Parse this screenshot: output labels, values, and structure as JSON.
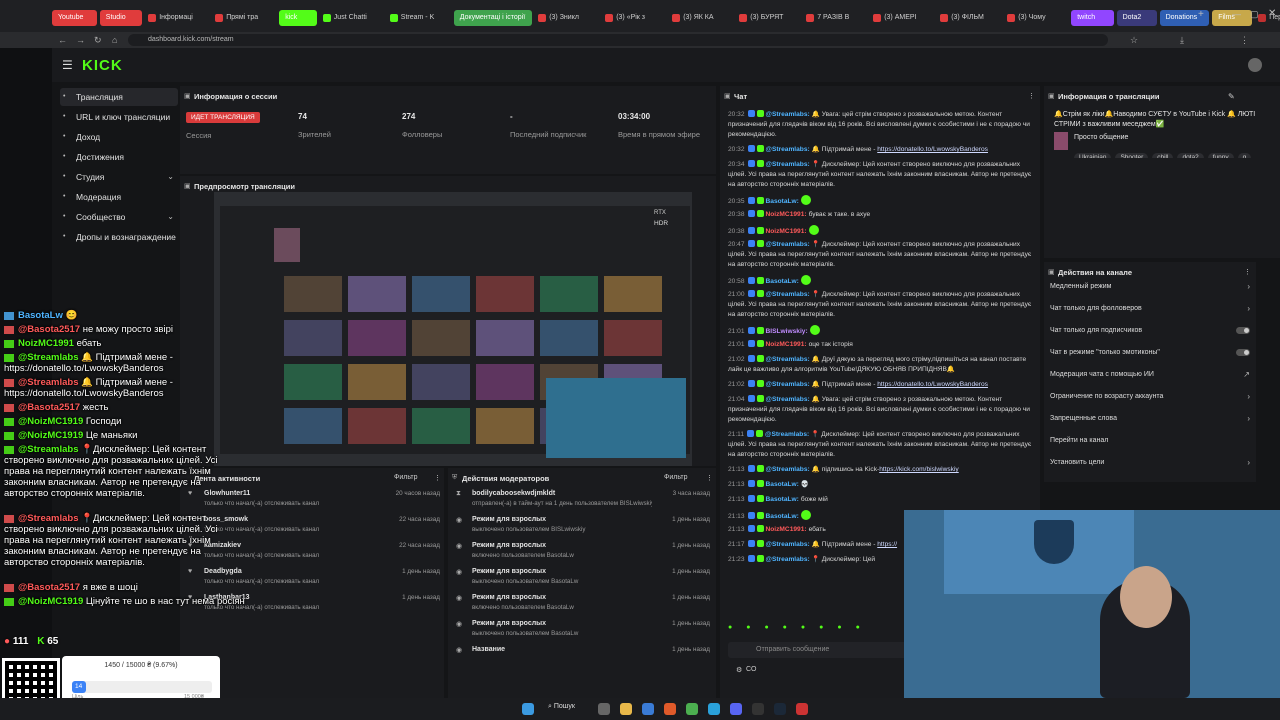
{
  "browser": {
    "tabs": [
      {
        "label": "Youtube",
        "color": "#e03c3c",
        "pill": true
      },
      {
        "label": "Studio",
        "color": "#e03c3c",
        "pill": true
      },
      {
        "label": "Інформаці",
        "color": "#e03c3c"
      },
      {
        "label": "Прямі тра",
        "color": "#e03c3c"
      },
      {
        "label": "kick",
        "color": "#53fc18",
        "pill": true
      },
      {
        "label": "Just Chatti",
        "color": "#53fc18"
      },
      {
        "label": "Stream - K",
        "color": "#53fc18"
      },
      {
        "label": "Документаці і історії",
        "color": "#3fa34d",
        "pill": true
      },
      {
        "label": "(3) Зникл",
        "color": "#e03c3c"
      },
      {
        "label": "(3) «Рік з",
        "color": "#e03c3c"
      },
      {
        "label": "(3) ЯК КА",
        "color": "#e03c3c"
      },
      {
        "label": "(3) БУРЯТ",
        "color": "#e03c3c"
      },
      {
        "label": "7 РАЗІВ В",
        "color": "#e03c3c"
      },
      {
        "label": "(3) АМЕРІ",
        "color": "#e03c3c"
      },
      {
        "label": "(3) ФІЛЬМ",
        "color": "#e03c3c"
      },
      {
        "label": "(3) Чому",
        "color": "#e03c3c"
      },
      {
        "label": "twitch",
        "color": "#9146ff",
        "pill": true
      },
      {
        "label": "Dota2",
        "color": "#3a3a7a",
        "pill": true
      },
      {
        "label": "Donations",
        "color": "#2f5fb3",
        "pill": true
      },
      {
        "label": "Films",
        "color": "#c7a84a",
        "pill": true
      },
      {
        "label": "Персона",
        "color": "#c03030"
      }
    ],
    "url": "dashboard.kick.com/stream",
    "new_tab": "+"
  },
  "app": {
    "logo": "KICK",
    "sidebar": [
      {
        "label": "Трансляция",
        "active": true
      },
      {
        "label": "URL и ключ трансляции"
      },
      {
        "label": "Доход"
      },
      {
        "label": "Достижения"
      },
      {
        "label": "Студия",
        "chev": "⌄"
      },
      {
        "label": "Модерация"
      },
      {
        "label": "Сообщество",
        "chev": "⌄"
      },
      {
        "label": "Дропы и вознаграждение"
      }
    ],
    "session": {
      "title": "Информация о сессии",
      "badge": "ИДЕТ ТРАНСЛЯЦИЯ",
      "badge_label": "Сессия",
      "stats": [
        {
          "value": "74",
          "label": "Зрителей"
        },
        {
          "value": "274",
          "label": "Фолловеры"
        },
        {
          "value": "-",
          "label": "Последний подписчик"
        },
        {
          "value": "03:34:00",
          "label": "Время в прямом эфире"
        }
      ]
    },
    "preview": {
      "title": "Предпросмотр трансляции",
      "hdr": "HDR",
      "rtx": "RTX"
    },
    "chat": {
      "title": "Чат",
      "input_placeholder": "Отправить сообщение",
      "viewers_mini": "CO",
      "messages": [
        {
          "t": "20:32",
          "u": "@Streamlabs:",
          "c": "#4fb4ff",
          "m": "🔔 Увага: цей стрім створено з розважальною метою. Контент призначений для глядачів віком від 16 років. Всі висловлені думки є особистими і не є порадою чи рекомендацією."
        },
        {
          "t": "20:32",
          "u": "@Streamlabs:",
          "c": "#4fb4ff",
          "m": "🔔 Підтримай мене - ",
          "link": "https://donatello.to/LwowskyBanderos"
        },
        {
          "t": "20:34",
          "u": "@Streamlabs:",
          "c": "#4fb4ff",
          "m": "📍 Дисклеймер: Цей контент створено виключно для розважальних цілей. Усі права на переглянутий контент належать їхнім законним власникам. Автор не претендує на авторство сторонніх матеріалів."
        },
        {
          "t": "20:35",
          "u": "BasotaLw:",
          "c": "#4fb4ff",
          "m": "",
          "emo": true
        },
        {
          "t": "20:38",
          "u": "NoizMC1991:",
          "c": "#ff5a5a",
          "m": "буває ж таке. в ахуе"
        },
        {
          "t": "20:38",
          "u": "NoizMC1991:",
          "c": "#ff5a5a",
          "m": "",
          "emo": true
        },
        {
          "t": "20:47",
          "u": "@Streamlabs:",
          "c": "#4fb4ff",
          "m": "📍 Дисклеймер: Цей контент створено виключно для розважальних цілей. Усі права на переглянутий контент належать їхнім законним власникам. Автор не претендує на авторство сторонніх матеріалів."
        },
        {
          "t": "20:58",
          "u": "BasotaLw:",
          "c": "#4fb4ff",
          "m": "",
          "emo": true
        },
        {
          "t": "21:00",
          "u": "@Streamlabs:",
          "c": "#4fb4ff",
          "m": "📍 Дисклеймер: Цей контент створено виключно для розважальних цілей. Усі права на переглянутий контент належать їхнім законним власникам. Автор не претендує на авторство сторонніх матеріалів."
        },
        {
          "t": "21:01",
          "u": "BISLwiwskiy:",
          "c": "#c08cff",
          "m": "",
          "emo": true
        },
        {
          "t": "21:01",
          "u": "NoizMC1991:",
          "c": "#ff5a5a",
          "m": "оце так історія"
        },
        {
          "t": "21:02",
          "u": "@Streamlabs:",
          "c": "#4fb4ff",
          "m": "🔔 Друї дякую за перегляд мого стріму,підпишіться на канал поставте лайк це важливо для алгоритмів YouTube!ДЯКУЮ ОБНЯВ ПРИПІДНЯВ🔔"
        },
        {
          "t": "21:02",
          "u": "@Streamlabs:",
          "c": "#4fb4ff",
          "m": "🔔 Підтримай мене - ",
          "link": "https://donatello.to/LwowskyBanderos"
        },
        {
          "t": "21:04",
          "u": "@Streamlabs:",
          "c": "#4fb4ff",
          "m": "🔔 Увага: цей стрім створено з розважальною метою. Контент призначений для глядачів віком від 16 років. Всі висловлені думки є особистими і не є порадою чи рекомендацією."
        },
        {
          "t": "21:11",
          "u": "@Streamlabs:",
          "c": "#4fb4ff",
          "m": "📍 Дисклеймер: Цей контент створено виключно для розважальних цілей. Усі права на переглянутий контент належать їхнім законним власникам. Автор не претендує на авторство сторонніх матеріалів."
        },
        {
          "t": "21:13",
          "u": "@Streamlabs:",
          "c": "#4fb4ff",
          "m": "🔔 підпишись на Kick-",
          "link": "https://kick.com/bislwiwskiy"
        },
        {
          "t": "21:13",
          "u": "BasotaLw:",
          "c": "#4fb4ff",
          "m": "💀"
        },
        {
          "t": "21:13",
          "u": "BasotaLw:",
          "c": "#4fb4ff",
          "m": "боже мій"
        },
        {
          "t": "21:13",
          "u": "BasotaLw:",
          "c": "#4fb4ff",
          "m": "",
          "emo": true
        },
        {
          "t": "21:13",
          "u": "NoizMC1991:",
          "c": "#ff5a5a",
          "m": "ебать"
        },
        {
          "t": "21:17",
          "u": "@Streamlabs:",
          "c": "#4fb4ff",
          "m": "🔔 Підтримай мене - ",
          "link": "https://"
        },
        {
          "t": "21:23",
          "u": "@Streamlabs:",
          "c": "#4fb4ff",
          "m": "📍 Дисклеймер: Цей"
        }
      ]
    },
    "stream_info": {
      "title": "Информация о трансляции",
      "stream_title": "🔔Стрім як ліки🔔Наводимо СУЄТУ в YouTube і Kick 🔔 ЛЮТІ СТРІМИ з важливим меседжем✅",
      "category": "Просто общение",
      "tags": [
        "Ukrainian",
        "Shooter",
        "chill",
        "dota2",
        "funny",
        "g"
      ]
    },
    "channel_actions": {
      "title": "Действия на канале",
      "items": [
        {
          "label": "Медленный режим",
          "kind": "chev"
        },
        {
          "label": "Чат только для фолловеров",
          "kind": "chev"
        },
        {
          "label": "Чат только для подписчиков",
          "kind": "toggle"
        },
        {
          "label": "Чат в режиме \"только эмотиконы\"",
          "kind": "toggle"
        },
        {
          "label": "Модерация чата с помощью ИИ",
          "kind": "ext"
        },
        {
          "label": "Ограничение по возрасту аккаунта",
          "kind": "chev"
        },
        {
          "label": "Запрещенные слова",
          "kind": "chev"
        },
        {
          "label": "Перейти на канал",
          "kind": "none"
        },
        {
          "label": "Установить цели",
          "kind": "chev"
        }
      ]
    },
    "activity": {
      "title": "Лента активности",
      "filter": "Фильтр",
      "rows": [
        {
          "name": "Glowhunter11",
          "sub": "только что начал(-а) отслеживать канал",
          "time": "20 часов назад"
        },
        {
          "name": "boss_smowk",
          "sub": "только что начал(-а) отслеживать канал",
          "time": "22 часа назад"
        },
        {
          "name": "kamizakiev",
          "sub": "только что начал(-а) отслеживать канал",
          "time": "22 часа назад"
        },
        {
          "name": "Deadbygda",
          "sub": "только что начал(-а) отслеживать канал",
          "time": "1 день назад"
        },
        {
          "name": "Lasthanbar13",
          "sub": "только что начал(-а) отслеживать канал",
          "time": "1 день назад"
        }
      ]
    },
    "mod_actions": {
      "title": "Действия модераторов",
      "filter": "Фильтр",
      "rows": [
        {
          "name": "bodilycaboosekwdjmkldt",
          "sub": "отправлен(-а) в тайм-аут на 1 день пользователем BISLwiwskiy",
          "time": "3 часа назад"
        },
        {
          "name": "Режим для взрослых",
          "sub": "выключено пользователем BISLwiwskiy",
          "time": "1 день назад"
        },
        {
          "name": "Режим для взрослых",
          "sub": "включено пользователем BasotaLw",
          "time": "1 день назад"
        },
        {
          "name": "Режим для взрослых",
          "sub": "выключено пользователем BasotaLw",
          "time": "1 день назад"
        },
        {
          "name": "Режим для взрослых",
          "sub": "включено пользователем BasotaLw",
          "time": "1 день назад"
        },
        {
          "name": "Режим для взрослых",
          "sub": "выключено пользователем BasotaLw",
          "time": "1 день назад"
        },
        {
          "name": "Название",
          "sub": "",
          "time": "1 день назад"
        }
      ]
    }
  },
  "overlay": {
    "chat": [
      {
        "u": "BasotaLw",
        "c": "b",
        "m": "😊"
      },
      {
        "u": "@Basota2517",
        "c": "r",
        "m": "не можу просто звірі"
      },
      {
        "u": "NoizMC1991",
        "c": "g",
        "m": "ебать"
      },
      {
        "u": "@Streamlabs",
        "c": "g",
        "m": "🔔 Підтримай мене - https://donatello.to/LwowskyBanderos"
      },
      {
        "u": "@Streamlabs",
        "c": "r",
        "m": "🔔 Підтримай мене - https://donatello.to/LwowskyBanderos"
      },
      {
        "u": "@Basota2517",
        "c": "r",
        "m": "жесть"
      },
      {
        "u": "@NoizMC1919",
        "c": "g",
        "m": "Господи"
      },
      {
        "u": "@NoizMC1919",
        "c": "g",
        "m": "Це маньяки"
      },
      {
        "u": "@Streamlabs",
        "c": "g",
        "m": "📍Дисклеймер: Цей контент створено виключно для розважальних цілей. Усі права на переглянутий контент належать їхнім законним власникам. Автор не претендує на авторство сторонніх матеріалів."
      },
      {
        "u": "@Streamlabs",
        "c": "r",
        "m": "📍Дисклеймер: Цей контент створено виключно для розважальних цілей. Усі права на переглянутий контент належать їхнім законним власникам. Автор не претендує на авторство сторонніх матеріалів."
      },
      {
        "u": "@Basota2517",
        "c": "r",
        "m": "я вже в шоці"
      },
      {
        "u": "@NoizMC1919",
        "c": "g",
        "m": "Цінуйте те шо в нас тут нема росіян"
      }
    ],
    "viewers": "111",
    "kick_viewers": "65",
    "goal_text": "1450 / 15000 ₴ (9.67%)",
    "goal_progress": 0.0967,
    "goal_start": "Ціль",
    "goal_end": "15 000₴",
    "goal_badge": "14"
  },
  "taskbar": {
    "search": "Пошук"
  },
  "colors": {
    "kick_green": "#53fc18",
    "live_red": "#d93b3b"
  }
}
